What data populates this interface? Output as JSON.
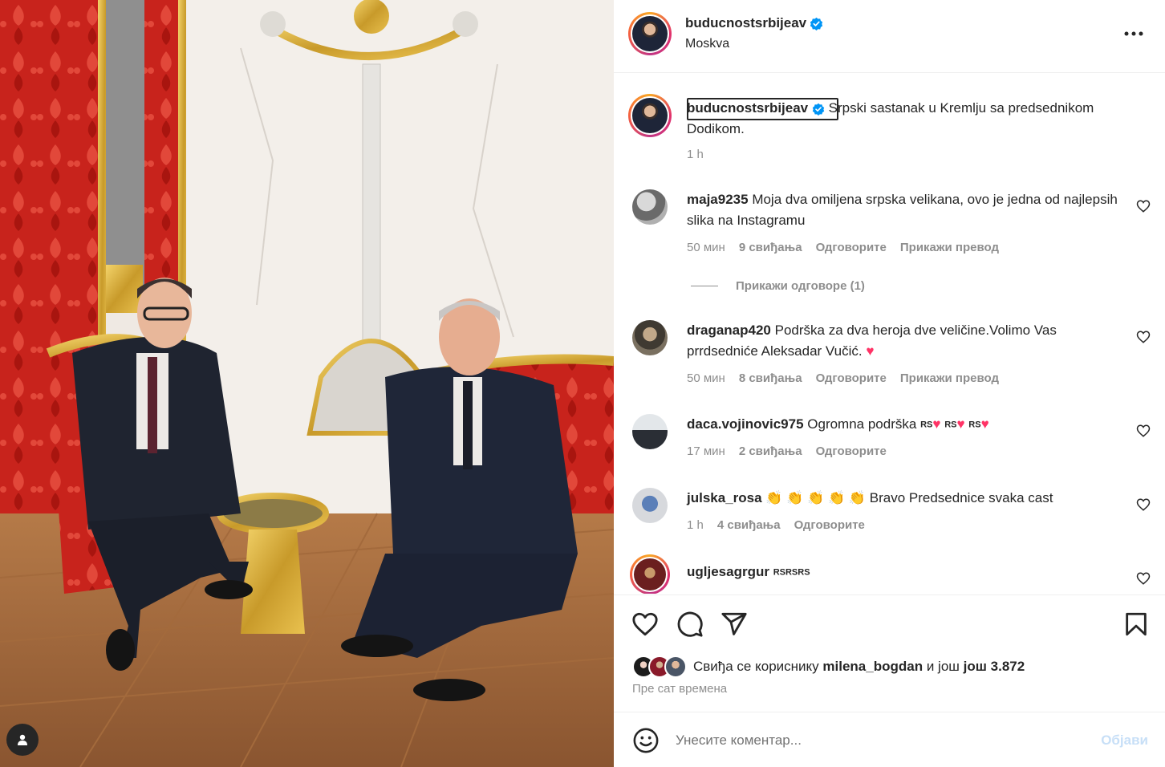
{
  "post": {
    "username": "buducnostsrbijeav",
    "location": "Moskva",
    "caption": "Srpski sastanak u Kremlju sa predsednikom Dodikom.",
    "caption_time": "1 h"
  },
  "comments": [
    {
      "username": "maja9235",
      "text": "Moja dva omiljena srpska velikana, ovo je jedna od najlepsih slika na Instagramu",
      "time": "50 мин",
      "likes": "9 свиђања",
      "reply": "Одговорите",
      "translate": "Прикажи превод",
      "view_replies": "Прикажи одговоре (1)"
    },
    {
      "username": "draganap420",
      "text": "Podrška za dva heroja dve veličine.Volimo Vas prrdsedniće Aleksadar Vučić.",
      "emoji": "♥",
      "time": "50 мин",
      "likes": "8 свиђања",
      "reply": "Одговорите",
      "translate": "Прикажи превод"
    },
    {
      "username": "daca.vojinovic975",
      "text": "Ogromna podrška",
      "flag": "RS",
      "emoji": "♥",
      "time": "17 мин",
      "likes": "2 свиђања",
      "reply": "Одговорите"
    },
    {
      "username": "julska_rosa",
      "claps": "👏 👏 👏 👏 👏",
      "text": "Bravo Predsednice svaka cast",
      "time": "1 h",
      "likes": "4 свиђања",
      "reply": "Одговорите"
    },
    {
      "username": "ugljesagrgur",
      "text": "RSRSRS"
    }
  ],
  "likes_summary": {
    "prefix": "Свиђа се кориснику",
    "user": "milena_bogdan",
    "middle": "и још",
    "rest": "још 3.872"
  },
  "time_ago": "Пре сат времена",
  "comment_box": {
    "placeholder": "Унесите коментар...",
    "post_label": "Објави"
  },
  "colors": {
    "verified": "#0095f6",
    "heart": "#ff3366",
    "post_disabled": "#c7dff7"
  },
  "icons": [
    "user-tag-icon",
    "verified-badge-icon",
    "more-options-icon",
    "heart-icon",
    "comment-icon",
    "share-icon",
    "bookmark-icon",
    "emoji-icon"
  ]
}
